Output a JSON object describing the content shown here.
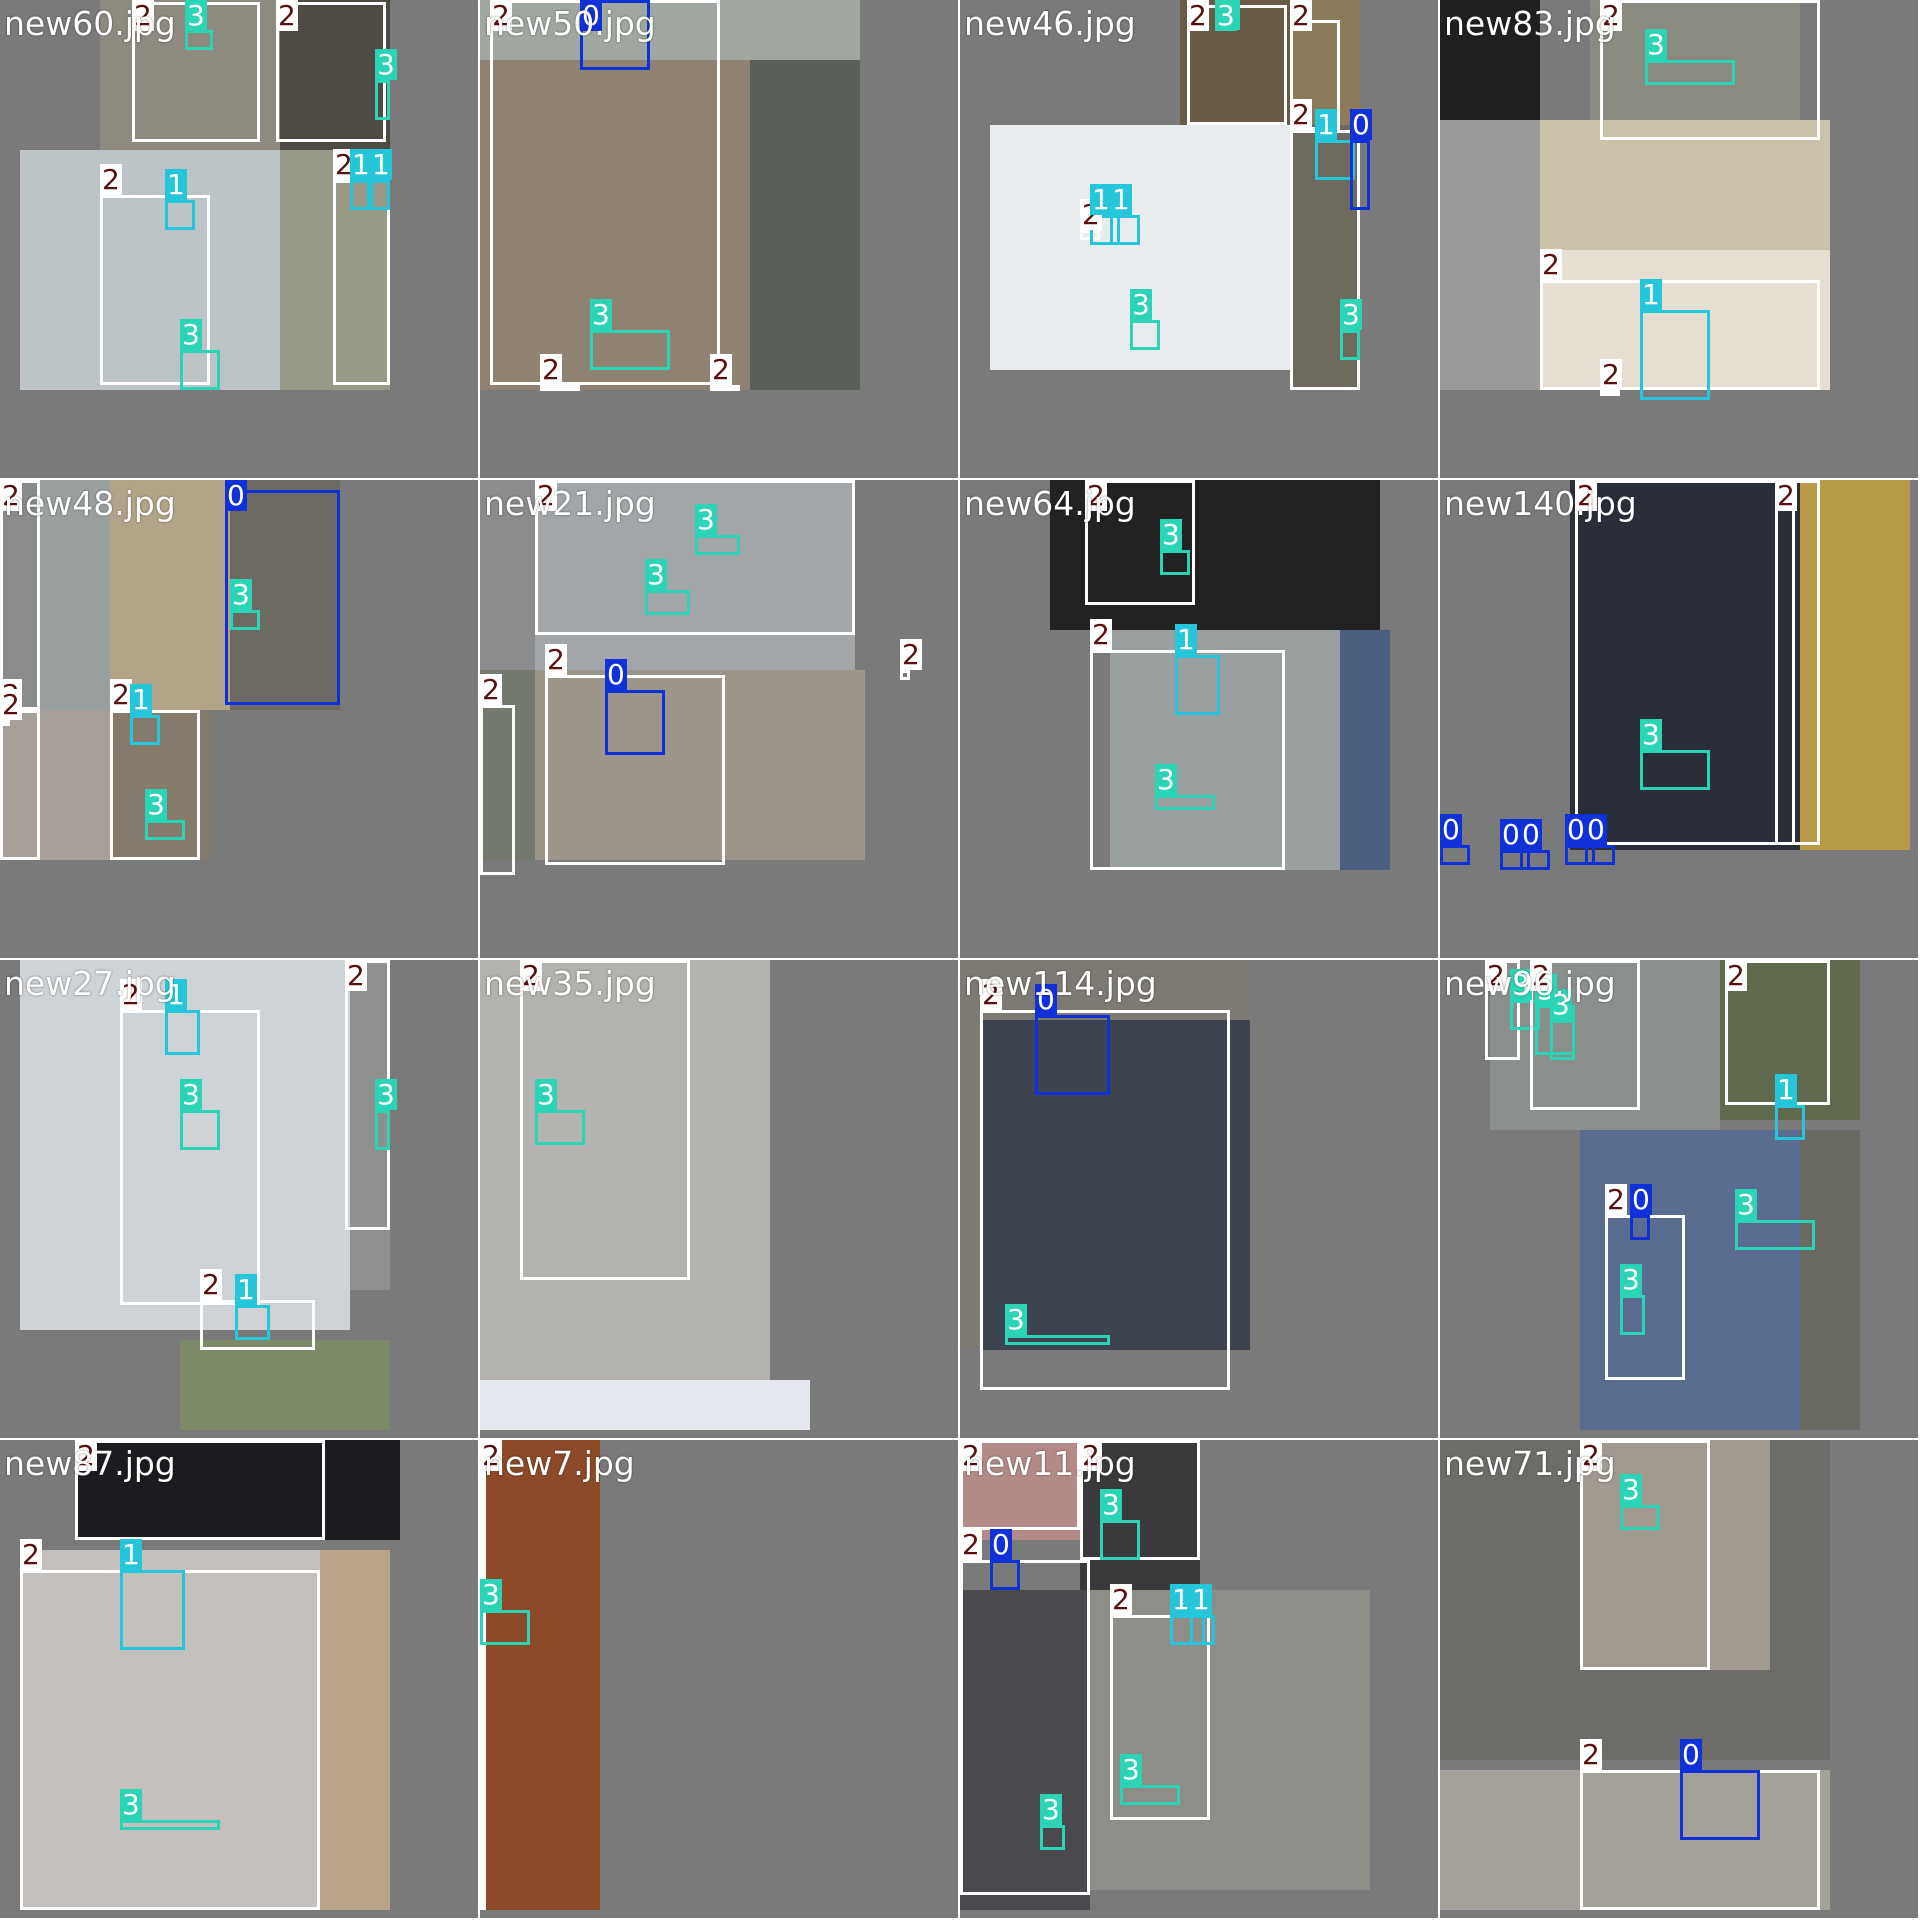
{
  "image": {
    "description_free": true
  },
  "colors": {
    "class_0": "#1030d8",
    "class_1": "#26c6da",
    "class_2": "#ffffff",
    "class_3": "#2bd4b4",
    "label_2_bg": "#ffffff",
    "label_2_fg": "#5a1010",
    "label_other_fg": "#ffffff",
    "tile_bg": "#7a7a7a"
  },
  "tiles": [
    {
      "name": "new60.jpg",
      "boxes": [
        {
          "cls": "2",
          "label": "2"
        },
        {
          "cls": "3",
          "label": "3"
        },
        {
          "cls": "2",
          "label": "2"
        },
        {
          "cls": "3",
          "label": "3"
        },
        {
          "cls": "2",
          "label": "2"
        },
        {
          "cls": "1",
          "label": "1"
        },
        {
          "cls": "3",
          "label": "3"
        },
        {
          "cls": "2",
          "label": "2"
        },
        {
          "cls": "1",
          "label": "1"
        },
        {
          "cls": "1",
          "label": "1"
        }
      ]
    },
    {
      "name": "new50.jpg",
      "boxes": [
        {
          "cls": "2",
          "label": "2"
        },
        {
          "cls": "0",
          "label": "0"
        },
        {
          "cls": "3",
          "label": "3"
        },
        {
          "cls": "2",
          "label": "2"
        },
        {
          "cls": "2",
          "label": "2"
        }
      ]
    },
    {
      "name": "new46.jpg",
      "boxes": [
        {
          "cls": "2",
          "label": "2"
        },
        {
          "cls": "3",
          "label": "3"
        },
        {
          "cls": "2",
          "label": "2"
        },
        {
          "cls": "2",
          "label": "2"
        },
        {
          "cls": "1",
          "label": "1"
        },
        {
          "cls": "0",
          "label": "0"
        },
        {
          "cls": "2",
          "label": "2"
        },
        {
          "cls": "1",
          "label": "1"
        },
        {
          "cls": "1",
          "label": "1"
        },
        {
          "cls": "3",
          "label": "3"
        },
        {
          "cls": "3",
          "label": "3"
        }
      ]
    },
    {
      "name": "new83.jpg",
      "boxes": [
        {
          "cls": "2",
          "label": "2"
        },
        {
          "cls": "3",
          "label": "3"
        },
        {
          "cls": "2",
          "label": "2"
        },
        {
          "cls": "1",
          "label": "1"
        },
        {
          "cls": "2",
          "label": "2"
        }
      ]
    },
    {
      "name": "new48.jpg",
      "boxes": [
        {
          "cls": "2",
          "label": "2"
        },
        {
          "cls": "2",
          "label": "2"
        },
        {
          "cls": "0",
          "label": "0"
        },
        {
          "cls": "3",
          "label": "3"
        },
        {
          "cls": "2",
          "label": "2"
        },
        {
          "cls": "2",
          "label": "2"
        },
        {
          "cls": "1",
          "label": "1"
        },
        {
          "cls": "3",
          "label": "3"
        }
      ]
    },
    {
      "name": "new21.jpg",
      "boxes": [
        {
          "cls": "3",
          "label": "3"
        },
        {
          "cls": "3",
          "label": "3"
        },
        {
          "cls": "2",
          "label": "2"
        },
        {
          "cls": "2",
          "label": "2"
        },
        {
          "cls": "0",
          "label": "0"
        },
        {
          "cls": "2",
          "label": "2"
        },
        {
          "cls": "2",
          "label": "2"
        }
      ]
    },
    {
      "name": "new64.jpg",
      "boxes": [
        {
          "cls": "2",
          "label": "2"
        },
        {
          "cls": "3",
          "label": "3"
        },
        {
          "cls": "2",
          "label": "2"
        },
        {
          "cls": "1",
          "label": "1"
        },
        {
          "cls": "3",
          "label": "3"
        }
      ]
    },
    {
      "name": "new140.jpg",
      "boxes": [
        {
          "cls": "2",
          "label": "2"
        },
        {
          "cls": "3",
          "label": "3"
        },
        {
          "cls": "2",
          "label": "2"
        },
        {
          "cls": "0",
          "label": "0"
        },
        {
          "cls": "0",
          "label": "0"
        },
        {
          "cls": "0",
          "label": "0"
        },
        {
          "cls": "0",
          "label": "0"
        },
        {
          "cls": "0",
          "label": "0"
        }
      ]
    },
    {
      "name": "new27.jpg",
      "boxes": [
        {
          "cls": "2",
          "label": "2"
        },
        {
          "cls": "1",
          "label": "1"
        },
        {
          "cls": "3",
          "label": "3"
        },
        {
          "cls": "2",
          "label": "2"
        },
        {
          "cls": "3",
          "label": "3"
        },
        {
          "cls": "2",
          "label": "2"
        },
        {
          "cls": "1",
          "label": "1"
        }
      ]
    },
    {
      "name": "new35.jpg",
      "boxes": [
        {
          "cls": "2",
          "label": "2"
        },
        {
          "cls": "3",
          "label": "3"
        }
      ]
    },
    {
      "name": "new114.jpg",
      "boxes": [
        {
          "cls": "2",
          "label": "2"
        },
        {
          "cls": "0",
          "label": "0"
        },
        {
          "cls": "3",
          "label": "3"
        }
      ]
    },
    {
      "name": "new96.jpg",
      "boxes": [
        {
          "cls": "2",
          "label": "2"
        },
        {
          "cls": "3",
          "label": "3"
        },
        {
          "cls": "3",
          "label": "3"
        },
        {
          "cls": "2",
          "label": "2"
        },
        {
          "cls": "3",
          "label": "3"
        },
        {
          "cls": "2",
          "label": "2"
        },
        {
          "cls": "1",
          "label": "1"
        },
        {
          "cls": "3",
          "label": "3"
        },
        {
          "cls": "2",
          "label": "2"
        },
        {
          "cls": "0",
          "label": "0"
        },
        {
          "cls": "3",
          "label": "3"
        }
      ]
    },
    {
      "name": "new87.jpg",
      "boxes": [
        {
          "cls": "2",
          "label": "2"
        },
        {
          "cls": "2",
          "label": "2"
        },
        {
          "cls": "1",
          "label": "1"
        },
        {
          "cls": "3",
          "label": "3"
        }
      ]
    },
    {
      "name": "new7.jpg",
      "boxes": [
        {
          "cls": "2",
          "label": "2"
        },
        {
          "cls": "3",
          "label": "3"
        }
      ]
    },
    {
      "name": "new11.jpg",
      "boxes": [
        {
          "cls": "2",
          "label": "2"
        },
        {
          "cls": "2",
          "label": "2"
        },
        {
          "cls": "3",
          "label": "3"
        },
        {
          "cls": "2",
          "label": "2"
        },
        {
          "cls": "0",
          "label": "0"
        },
        {
          "cls": "3",
          "label": "3"
        },
        {
          "cls": "2",
          "label": "2"
        },
        {
          "cls": "1",
          "label": "1"
        },
        {
          "cls": "1",
          "label": "1"
        },
        {
          "cls": "3",
          "label": "3"
        }
      ]
    },
    {
      "name": "new71.jpg",
      "boxes": [
        {
          "cls": "2",
          "label": "2"
        },
        {
          "cls": "3",
          "label": "3"
        },
        {
          "cls": "2",
          "label": "2"
        },
        {
          "cls": "0",
          "label": "0"
        }
      ]
    }
  ]
}
